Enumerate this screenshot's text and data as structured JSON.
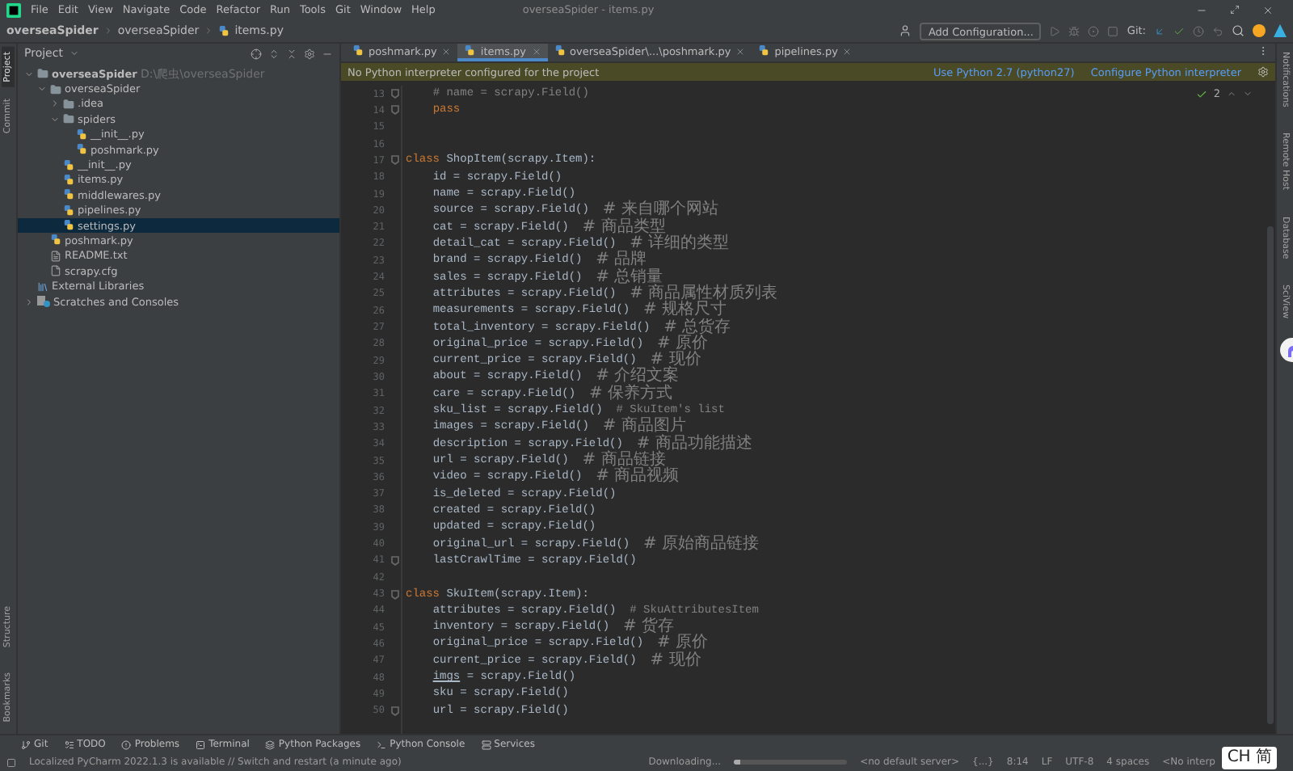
{
  "window": {
    "title": "overseaSpider - items.py",
    "menu": [
      "File",
      "Edit",
      "View",
      "Navigate",
      "Code",
      "Refactor",
      "Run",
      "Tools",
      "Git",
      "Window",
      "Help"
    ]
  },
  "breadcrumb": [
    "overseaSpider",
    "overseaSpider",
    "items.py"
  ],
  "toolbar": {
    "run_config": "Add Configuration...",
    "git_label": "Git:"
  },
  "left_stripe": [
    {
      "label": "Project",
      "selected": true
    },
    {
      "label": "Commit",
      "selected": false
    }
  ],
  "left_stripe_bottom": [
    {
      "label": "Structure"
    },
    {
      "label": "Bookmarks"
    }
  ],
  "right_stripe": [
    {
      "label": "Notifications"
    },
    {
      "label": "Remote Host"
    },
    {
      "label": "Database"
    },
    {
      "label": "SciView"
    }
  ],
  "project": {
    "title": "Project",
    "tree": [
      {
        "label": "overseaSpider",
        "hint": "D:\\爬虫\\overseaSpider",
        "kind": "folder",
        "expanded": true,
        "selected": false,
        "children": [
          {
            "label": "overseaSpider",
            "kind": "folder",
            "expanded": true,
            "selected": false,
            "children": [
              {
                "label": ".idea",
                "kind": "folder",
                "expanded": false,
                "selected": false
              },
              {
                "label": "spiders",
                "kind": "folder",
                "expanded": true,
                "selected": false,
                "children": [
                  {
                    "label": "__init__.py",
                    "kind": "python",
                    "selected": false
                  },
                  {
                    "label": "poshmark.py",
                    "kind": "python",
                    "selected": false
                  }
                ]
              },
              {
                "label": "__init__.py",
                "kind": "python",
                "selected": false
              },
              {
                "label": "items.py",
                "kind": "python",
                "selected": false
              },
              {
                "label": "middlewares.py",
                "kind": "python",
                "selected": false
              },
              {
                "label": "pipelines.py",
                "kind": "python",
                "selected": false
              },
              {
                "label": "settings.py",
                "kind": "python",
                "selected": true
              }
            ]
          },
          {
            "label": "poshmark.py",
            "kind": "python",
            "selected": false
          },
          {
            "label": "README.txt",
            "kind": "text",
            "selected": false
          },
          {
            "label": "scrapy.cfg",
            "kind": "config",
            "selected": false
          }
        ]
      },
      {
        "label": "External Libraries",
        "kind": "library",
        "selected": false
      },
      {
        "label": "Scratches and Consoles",
        "kind": "scratch",
        "expanded": false,
        "selected": false
      }
    ]
  },
  "tabs": [
    {
      "label": "poshmark.py",
      "selected": false
    },
    {
      "label": "items.py",
      "selected": true
    },
    {
      "label": "overseaSpider\\...\\poshmark.py",
      "selected": false
    },
    {
      "label": "pipelines.py",
      "selected": false
    }
  ],
  "banner": {
    "message": "No Python interpreter configured for the project",
    "actions": [
      "Use Python 2.7 (python27)",
      "Configure Python interpreter"
    ]
  },
  "inspections": {
    "count": "2"
  },
  "code": [
    {
      "number": "13",
      "fold": true,
      "tokens": [
        {
          "text": "    # name = scrapy.Field()",
          "kind": "comment"
        }
      ]
    },
    {
      "number": "14",
      "fold": true,
      "tokens": [
        {
          "text": "    pass",
          "kind": "keyword"
        }
      ]
    },
    {
      "number": "15",
      "fold": false
    },
    {
      "number": "16",
      "fold": false
    },
    {
      "number": "17",
      "fold": true,
      "tokens": [
        {
          "text": "class",
          "kind": "keyword"
        },
        {
          "text": " ShopItem(scrapy.Item):",
          "kind": "plain"
        }
      ]
    },
    {
      "number": "18",
      "fold": false,
      "tokens": [
        {
          "text": "    id = scrapy.Field()",
          "kind": "plain"
        }
      ]
    },
    {
      "number": "19",
      "fold": false,
      "tokens": [
        {
          "text": "    name = scrapy.Field()",
          "kind": "plain"
        }
      ]
    },
    {
      "number": "20",
      "fold": false,
      "tokens": [
        {
          "text": "    source = scrapy.Field()  ",
          "kind": "plain"
        },
        {
          "text": "# 来自哪个网站",
          "kind": "comment"
        }
      ]
    },
    {
      "number": "21",
      "fold": false,
      "tokens": [
        {
          "text": "    cat = scrapy.Field()  ",
          "kind": "plain"
        },
        {
          "text": "# 商品类型",
          "kind": "comment"
        }
      ]
    },
    {
      "number": "22",
      "fold": false,
      "tokens": [
        {
          "text": "    detail_cat = scrapy.Field()  ",
          "kind": "plain"
        },
        {
          "text": "# 详细的类型",
          "kind": "comment"
        }
      ]
    },
    {
      "number": "23",
      "fold": false,
      "tokens": [
        {
          "text": "    brand = scrapy.Field()  ",
          "kind": "plain"
        },
        {
          "text": "# 品牌",
          "kind": "comment"
        }
      ]
    },
    {
      "number": "24",
      "fold": false,
      "tokens": [
        {
          "text": "    sales = scrapy.Field()  ",
          "kind": "plain"
        },
        {
          "text": "# 总销量",
          "kind": "comment"
        }
      ]
    },
    {
      "number": "25",
      "fold": false,
      "tokens": [
        {
          "text": "    attributes = scrapy.Field()  ",
          "kind": "plain"
        },
        {
          "text": "# 商品属性材质列表",
          "kind": "comment"
        }
      ]
    },
    {
      "number": "26",
      "fold": false,
      "tokens": [
        {
          "text": "    measurements = scrapy.Field()  ",
          "kind": "plain"
        },
        {
          "text": "# 规格尺寸",
          "kind": "comment"
        }
      ]
    },
    {
      "number": "27",
      "fold": false,
      "tokens": [
        {
          "text": "    total_inventory = scrapy.Field()  ",
          "kind": "plain"
        },
        {
          "text": "# 总货存",
          "kind": "comment"
        }
      ]
    },
    {
      "number": "28",
      "fold": false,
      "tokens": [
        {
          "text": "    original_price = scrapy.Field()  ",
          "kind": "plain"
        },
        {
          "text": "# 原价",
          "kind": "comment"
        }
      ]
    },
    {
      "number": "29",
      "fold": false,
      "tokens": [
        {
          "text": "    current_price = scrapy.Field()  ",
          "kind": "plain"
        },
        {
          "text": "# 现价",
          "kind": "comment"
        }
      ]
    },
    {
      "number": "30",
      "fold": false,
      "tokens": [
        {
          "text": "    about = scrapy.Field()  ",
          "kind": "plain"
        },
        {
          "text": "# 介绍文案",
          "kind": "comment"
        }
      ]
    },
    {
      "number": "31",
      "fold": false,
      "tokens": [
        {
          "text": "    care = scrapy.Field()  ",
          "kind": "plain"
        },
        {
          "text": "# 保养方式",
          "kind": "comment"
        }
      ]
    },
    {
      "number": "32",
      "fold": false,
      "tokens": [
        {
          "text": "    sku_list = scrapy.Field()  ",
          "kind": "plain"
        },
        {
          "text": "# SkuItem's list",
          "kind": "comment"
        }
      ]
    },
    {
      "number": "33",
      "fold": false,
      "tokens": [
        {
          "text": "    images = scrapy.Field()  ",
          "kind": "plain"
        },
        {
          "text": "# 商品图片",
          "kind": "comment"
        }
      ]
    },
    {
      "number": "34",
      "fold": false,
      "tokens": [
        {
          "text": "    description = scrapy.Field()  ",
          "kind": "plain"
        },
        {
          "text": "# 商品功能描述",
          "kind": "comment"
        }
      ]
    },
    {
      "number": "35",
      "fold": false,
      "tokens": [
        {
          "text": "    url = scrapy.Field()  ",
          "kind": "plain"
        },
        {
          "text": "# 商品链接",
          "kind": "comment"
        }
      ]
    },
    {
      "number": "36",
      "fold": false,
      "tokens": [
        {
          "text": "    video = scrapy.Field()  ",
          "kind": "plain"
        },
        {
          "text": "# 商品视频",
          "kind": "comment"
        }
      ]
    },
    {
      "number": "37",
      "fold": false,
      "tokens": [
        {
          "text": "    is_deleted = scrapy.Field()",
          "kind": "plain"
        }
      ]
    },
    {
      "number": "38",
      "fold": false,
      "tokens": [
        {
          "text": "    created = scrapy.Field()",
          "kind": "plain"
        }
      ]
    },
    {
      "number": "39",
      "fold": false,
      "tokens": [
        {
          "text": "    updated = scrapy.Field()",
          "kind": "plain"
        }
      ]
    },
    {
      "number": "40",
      "fold": false,
      "tokens": [
        {
          "text": "    original_url = scrapy.Field()  ",
          "kind": "plain"
        },
        {
          "text": "# 原始商品链接",
          "kind": "comment"
        }
      ]
    },
    {
      "number": "41",
      "fold": true,
      "tokens": [
        {
          "text": "    lastCrawlTime = scrapy.Field()",
          "kind": "plain"
        }
      ]
    },
    {
      "number": "42",
      "fold": false
    },
    {
      "number": "43",
      "fold": true,
      "tokens": [
        {
          "text": "class",
          "kind": "keyword"
        },
        {
          "text": " SkuItem(scrapy.Item):",
          "kind": "plain"
        }
      ]
    },
    {
      "number": "44",
      "fold": false,
      "tokens": [
        {
          "text": "    attributes = scrapy.Field()  ",
          "kind": "plain"
        },
        {
          "text": "# SkuAttributesItem",
          "kind": "comment"
        }
      ]
    },
    {
      "number": "45",
      "fold": false,
      "tokens": [
        {
          "text": "    inventory = scrapy.Field()  ",
          "kind": "plain"
        },
        {
          "text": "# 货存",
          "kind": "comment"
        }
      ]
    },
    {
      "number": "46",
      "fold": false,
      "tokens": [
        {
          "text": "    original_price = scrapy.Field()  ",
          "kind": "plain"
        },
        {
          "text": "# 原价",
          "kind": "comment"
        }
      ]
    },
    {
      "number": "47",
      "fold": false,
      "tokens": [
        {
          "text": "    current_price = scrapy.Field()  ",
          "kind": "plain"
        },
        {
          "text": "# 现价",
          "kind": "comment"
        }
      ]
    },
    {
      "number": "48",
      "fold": false,
      "tokens": [
        {
          "text": "    imgs",
          "kind": "typo"
        },
        {
          "text": " = scrapy.Field()",
          "kind": "plain"
        }
      ]
    },
    {
      "number": "49",
      "fold": false,
      "tokens": [
        {
          "text": "    sku = scrapy.Field()",
          "kind": "plain"
        }
      ]
    },
    {
      "number": "50",
      "fold": true,
      "tokens": [
        {
          "text": "    url = scrapy.Field()",
          "kind": "plain"
        }
      ]
    }
  ],
  "tool_windows": [
    {
      "label": "Git",
      "kind": "git"
    },
    {
      "label": "TODO",
      "kind": "todo"
    },
    {
      "label": "Problems",
      "kind": "problems"
    },
    {
      "label": "Terminal",
      "kind": "terminal"
    },
    {
      "label": "Python Packages",
      "kind": "packages"
    },
    {
      "label": "Python Console",
      "kind": "console"
    },
    {
      "label": "Services",
      "kind": "services"
    }
  ],
  "status_bar": {
    "message": "Localized PyCharm 2022.1.3 is available // Switch and restart (a minute ago)",
    "task": "Downloading...",
    "progress": {
      "level": 0.05
    },
    "items": [
      "<no default server>",
      "{...}",
      "8:14",
      "LF",
      "UTF-8",
      "4 spaces",
      "<No interp"
    ],
    "ime": "CH 简"
  }
}
